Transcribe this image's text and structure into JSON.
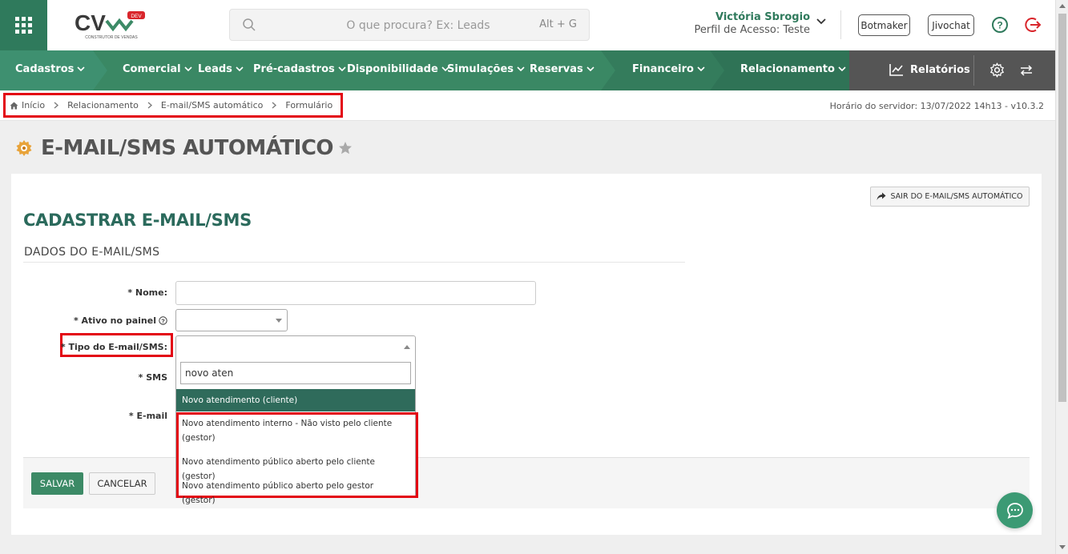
{
  "header": {
    "search_placeholder": "O que procura? Ex: Leads",
    "search_shortcut": "Alt + G",
    "user_name": "Victória Sbrogio",
    "user_profile": "Perfil de Acesso: Teste",
    "botmaker_label": "Botmaker",
    "jivochat_label": "Jivochat",
    "logo_text": "CV",
    "logo_badge": "DEV",
    "logo_tagline": "CONSTRUTOR DE VENDAS"
  },
  "nav": {
    "items": [
      {
        "label": "Cadastros"
      },
      {
        "label": "Comercial"
      },
      {
        "label": "Leads"
      },
      {
        "label": "Pré-cadastros"
      },
      {
        "label": "Disponibilidade"
      },
      {
        "label": "Simulações"
      },
      {
        "label": "Reservas"
      },
      {
        "label": "Financeiro"
      },
      {
        "label": "Relacionamento"
      }
    ],
    "reports_label": "Relatórios"
  },
  "breadcrumb": {
    "items": [
      "Início",
      "Relacionamento",
      "E-mail/SMS automático",
      "Formulário"
    ]
  },
  "server_time": "Horário do servidor: 13/07/2022 14h13 - v10.3.2",
  "page": {
    "title": "E-MAIL/SMS AUTOMÁTICO"
  },
  "form": {
    "exit_label": "SAIR DO E-MAIL/SMS AUTOMÁTICO",
    "title": "CADASTRAR E-MAIL/SMS",
    "section": "DADOS DO E-MAIL/SMS",
    "labels": {
      "nome": "* Nome:",
      "ativo": "* Ativo no painel",
      "tipo": "* Tipo do E-mail/SMS:",
      "sms": "* SMS",
      "email": "* E-mail"
    },
    "nome_value": "",
    "save_label": "SALVAR",
    "cancel_label": "CANCELAR"
  },
  "dropdown": {
    "search_value": "novo aten",
    "options": [
      "Novo atendimento (cliente)",
      "Novo atendimento interno - Não visto pelo cliente (gestor)",
      "Novo atendimento público aberto pelo cliente (gestor)",
      "Novo atendimento público aberto pelo gestor (gestor)"
    ]
  },
  "colors": {
    "brand_green": "#3c8a66",
    "dark_green": "#2f6b5b",
    "highlight_red": "#e30613"
  }
}
